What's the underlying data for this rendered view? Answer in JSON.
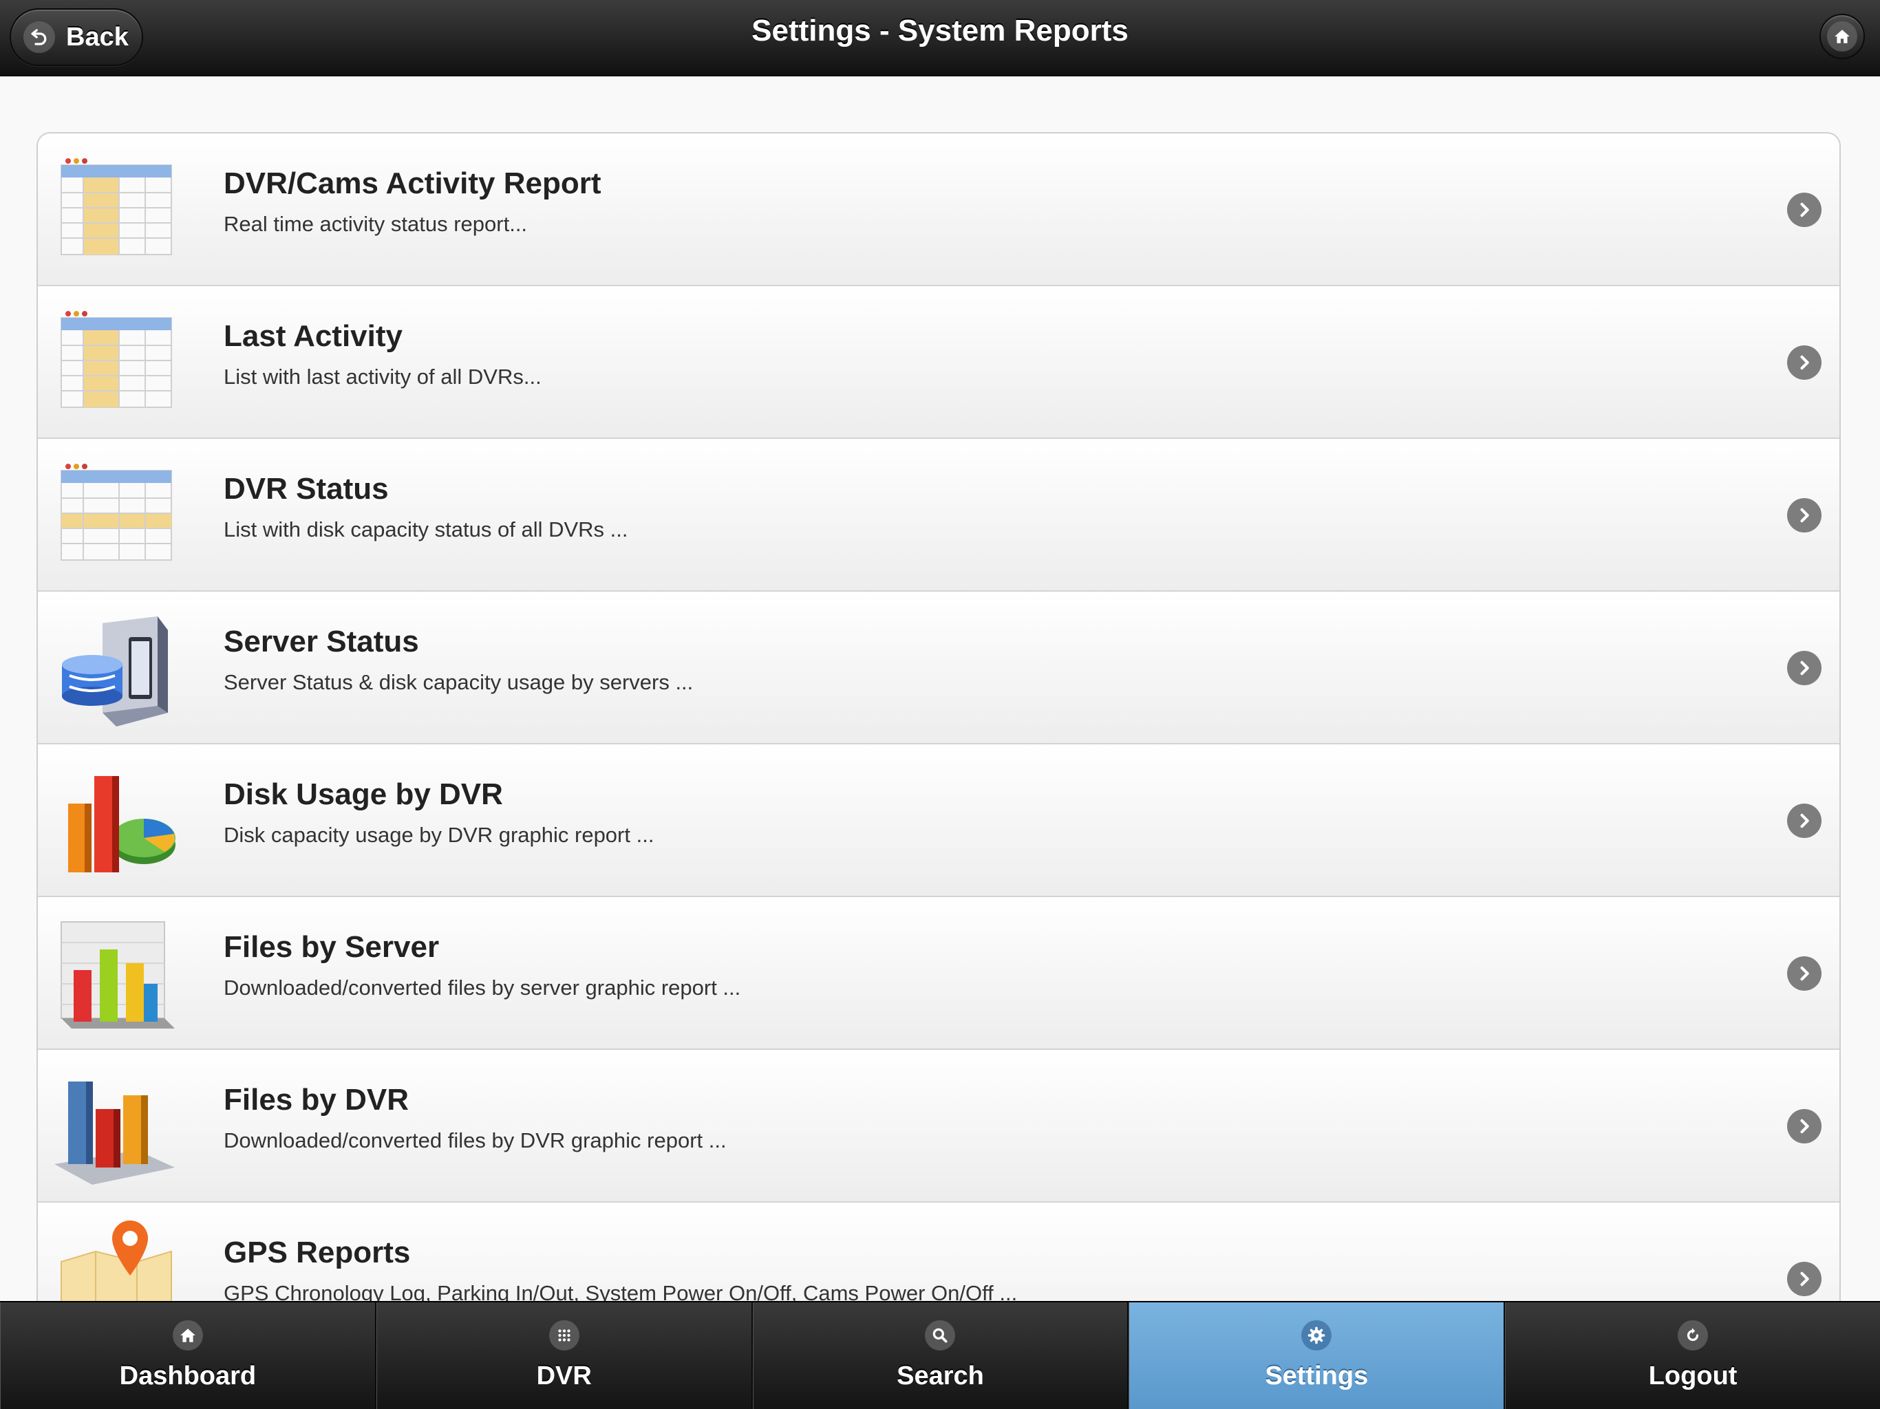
{
  "header": {
    "title": "Settings - System Reports",
    "back_label": "Back"
  },
  "reports": [
    {
      "title": "DVR/Cams Activity Report",
      "description": "Real time activity status report...",
      "icon": "spreadsheet-icon"
    },
    {
      "title": "Last Activity",
      "description": "List with last activity of all DVRs...",
      "icon": "spreadsheet-icon"
    },
    {
      "title": "DVR Status",
      "description": "List with disk capacity status of all DVRs ...",
      "icon": "spreadsheet-row-icon"
    },
    {
      "title": "Server Status",
      "description": "Server Status & disk capacity usage by servers ...",
      "icon": "server-database-icon"
    },
    {
      "title": "Disk Usage by DVR",
      "description": "Disk capacity usage by DVR graphic report ...",
      "icon": "bar-pie-chart-icon"
    },
    {
      "title": "Files by Server",
      "description": "Downloaded/converted files by server graphic report ...",
      "icon": "bar-chart-icon"
    },
    {
      "title": "Files by DVR",
      "description": "Downloaded/converted files by DVR graphic report ...",
      "icon": "3d-bar-chart-icon"
    },
    {
      "title": "GPS Reports",
      "description": "GPS Chronology Log, Parking In/Out, System Power On/Off, Cams Power On/Off ...",
      "icon": "map-pin-icon"
    }
  ],
  "navbar": {
    "tabs": [
      {
        "label": "Dashboard",
        "icon": "home-icon",
        "active": false
      },
      {
        "label": "DVR",
        "icon": "grid-icon",
        "active": false
      },
      {
        "label": "Search",
        "icon": "search-icon",
        "active": false
      },
      {
        "label": "Settings",
        "icon": "gear-icon",
        "active": true
      },
      {
        "label": "Logout",
        "icon": "refresh-icon",
        "active": false
      }
    ]
  },
  "colors": {
    "header_bg": "#1f1f1f",
    "active_tab": "#6aa6d6",
    "chevron": "#7d7d7d"
  }
}
